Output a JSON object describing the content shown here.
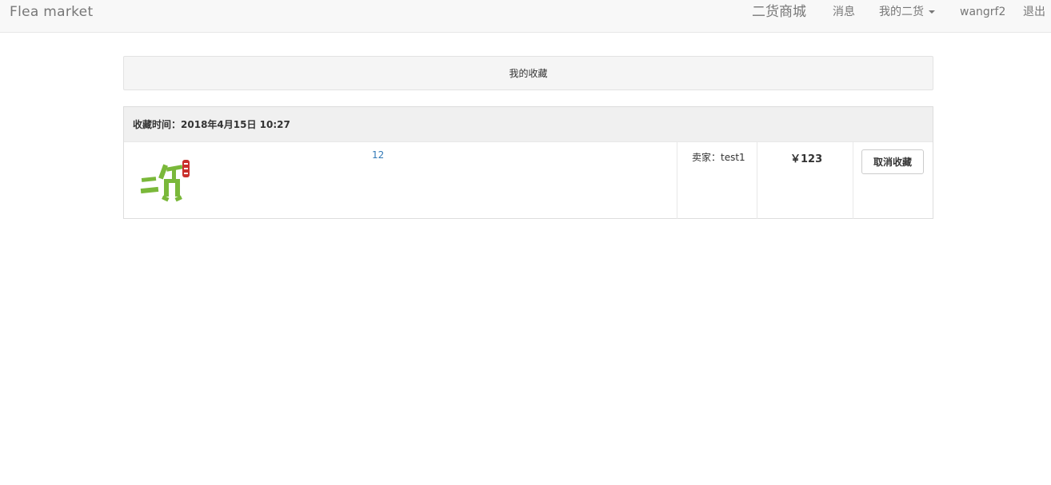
{
  "navbar": {
    "brand": "Flea market",
    "links": {
      "mall": "二货商城",
      "messages": "消息",
      "mine": "我的二货",
      "user": "wangrf2",
      "logout": "退出"
    }
  },
  "page": {
    "title": "我的收藏"
  },
  "favorites": [
    {
      "time_label": "收藏时间：",
      "time": "2018年4月15日 10:27",
      "item_title": "12",
      "seller": "卖家：test1",
      "price": "￥123",
      "action": "取消收藏",
      "thumb_text": "二货"
    }
  ],
  "colors": {
    "thumb_green": "#7ab83a",
    "thumb_red": "#c9302c",
    "link": "#337ab7"
  }
}
